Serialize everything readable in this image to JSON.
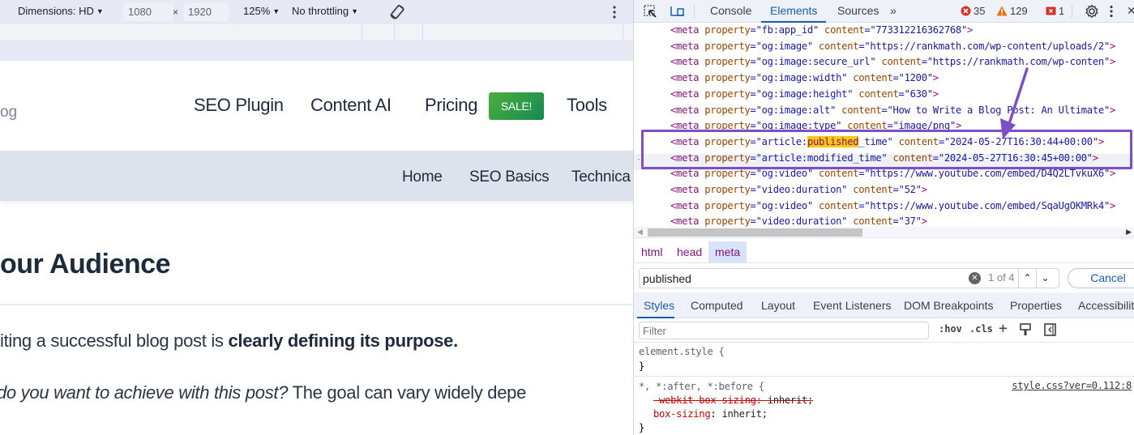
{
  "device_toolbar": {
    "dimensions_label": "Dimensions: HD",
    "width_value": "1080",
    "times_symbol": "×",
    "height_value": "1920",
    "zoom_label": "125%",
    "throttling_label": "No throttling"
  },
  "site": {
    "logo_fragment": "og",
    "main_nav": [
      "SEO Plugin",
      "Content AI",
      "Pricing",
      "Tools"
    ],
    "sale_badge": "SALE!",
    "sale_badge_colors": [
      "#4caf3a",
      "#138a54"
    ],
    "sub_nav": [
      "Home",
      "SEO Basics",
      "Technica"
    ]
  },
  "article": {
    "heading": "our Audience",
    "para1_plain": "iting a successful blog post is ",
    "para1_bold": "clearly defining its purpose.",
    "para2_italic": " do you want to achieve with this post?",
    "para2_plain": " The goal can vary widely depe"
  },
  "devtools": {
    "tabs": [
      "Console",
      "Elements",
      "Sources"
    ],
    "active_tab": "Elements",
    "more_tabs": "»",
    "errors_count": "35",
    "warnings_count": "129",
    "issues_count": "1",
    "dom_lines": [
      {
        "prop": "fb:app_id",
        "content": "773312216362768"
      },
      {
        "prop": "og:image",
        "content": "https://rankmath.com/wp-content/uploads/2"
      },
      {
        "prop": "og:image:secure_url",
        "content": "https://rankmath.com/wp-conten"
      },
      {
        "prop": "og:image:width",
        "content": "1200"
      },
      {
        "prop": "og:image:height",
        "content": "630"
      },
      {
        "prop": "og:image:alt",
        "content": "How to Write a Blog Post: An Ultimate"
      },
      {
        "prop": "og:image:type",
        "content": "image/png"
      },
      {
        "prop_prefix": "article:",
        "prop_match": "published",
        "prop_suffix": "_time",
        "content": "2024-05-27T16:30:44+00:00"
      },
      {
        "prop": "article:modified_time",
        "content": "2024-05-27T16:30:45+00:00"
      },
      {
        "prop": "og:video",
        "content": "https://www.youtube.com/embed/D4Q2LTvkuX6"
      },
      {
        "prop": "video:duration",
        "content": "52"
      },
      {
        "prop": "og:video",
        "content": "https://www.youtube.com/embed/SqaUgOKMRk4"
      },
      {
        "prop": "video:duration",
        "content": "37"
      }
    ],
    "dom_tag_open": "<meta ",
    "dom_attr_property": "property",
    "dom_attr_content": "content",
    "row_marker": "··",
    "annotation_color": "#7c4fc4",
    "breadcrumbs": [
      "html",
      "head",
      "meta"
    ],
    "search": {
      "value": "published",
      "result_count": "1 of 4",
      "cancel_label": "Cancel"
    },
    "styles_tabs": [
      "Styles",
      "Computed",
      "Layout",
      "Event Listeners",
      "DOM Breakpoints",
      "Properties",
      "Accessibility"
    ],
    "active_styles_tab": "Styles",
    "filter_placeholder": "Filter",
    "filter_tools": [
      ":hov",
      ".cls"
    ],
    "css": {
      "element_style_open": "element.style {",
      "close_brace": "}",
      "universal_selector": "*, *:after, *:before {",
      "source_link": "style.css?ver=0.112:8",
      "strike_prop": "-webkit-box-sizing",
      "strike_val": "inherit;",
      "prop": "box-sizing",
      "val": "inherit;"
    }
  }
}
